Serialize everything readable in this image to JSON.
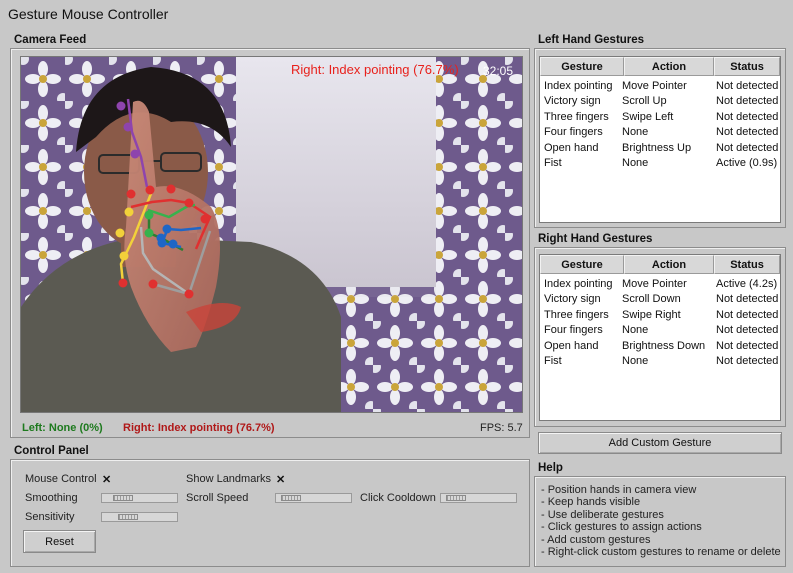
{
  "window": {
    "title": "Gesture Mouse Controller"
  },
  "camera": {
    "section_title": "Camera Feed",
    "overlay_label": "Right: Index pointing (76.7%)",
    "overlay_time": "32:05",
    "left_status": "Left: None (0%)",
    "right_status": "Right: Index pointing (76.7%)",
    "fps": "FPS: 5.7"
  },
  "left_hand": {
    "section_title": "Left Hand Gestures",
    "columns": [
      "Gesture",
      "Action",
      "Status"
    ],
    "rows": [
      [
        "Index pointing",
        "Move Pointer",
        "Not detected"
      ],
      [
        "Victory sign",
        "Scroll Up",
        "Not detected"
      ],
      [
        "Three fingers",
        "Swipe Left",
        "Not detected"
      ],
      [
        "Four fingers",
        "None",
        "Not detected"
      ],
      [
        "Open hand",
        "Brightness Up",
        "Not detected"
      ],
      [
        "Fist",
        "None",
        "Active (0.9s)"
      ]
    ]
  },
  "right_hand": {
    "section_title": "Right Hand Gestures",
    "columns": [
      "Gesture",
      "Action",
      "Status"
    ],
    "rows": [
      [
        "Index pointing",
        "Move Pointer",
        "Active (4.2s)"
      ],
      [
        "Victory sign",
        "Scroll Down",
        "Not detected"
      ],
      [
        "Three fingers",
        "Swipe Right",
        "Not detected"
      ],
      [
        "Four fingers",
        "None",
        "Not detected"
      ],
      [
        "Open hand",
        "Brightness Down",
        "Not detected"
      ],
      [
        "Fist",
        "None",
        "Not detected"
      ]
    ]
  },
  "add_gesture_label": "Add Custom Gesture",
  "control_panel": {
    "section_title": "Control Panel",
    "mouse_control_label": "Mouse Control",
    "mouse_control_check": "✕",
    "show_landmarks_label": "Show Landmarks",
    "show_landmarks_check": "✕",
    "smoothing_label": "Smoothing",
    "scroll_speed_label": "Scroll Speed",
    "click_cooldown_label": "Click Cooldown",
    "sensitivity_label": "Sensitivity",
    "reset_label": "Reset",
    "smoothing_value": 0.2,
    "scroll_speed_value": 0.1,
    "click_cooldown_value": 0.1,
    "sensitivity_value": 0.3
  },
  "help": {
    "section_title": "Help",
    "lines": [
      "- Position hands in camera view",
      "- Keep hands visible",
      "- Use deliberate gestures",
      "- Click gestures to assign actions",
      "- Add custom gestures",
      "- Right-click custom gestures to rename or delete"
    ]
  },
  "colors": {
    "window_bg": "#c8c8c8",
    "overlay_red": "#e8211c",
    "status_green": "#1e7a1e",
    "status_red": "#b01818"
  }
}
